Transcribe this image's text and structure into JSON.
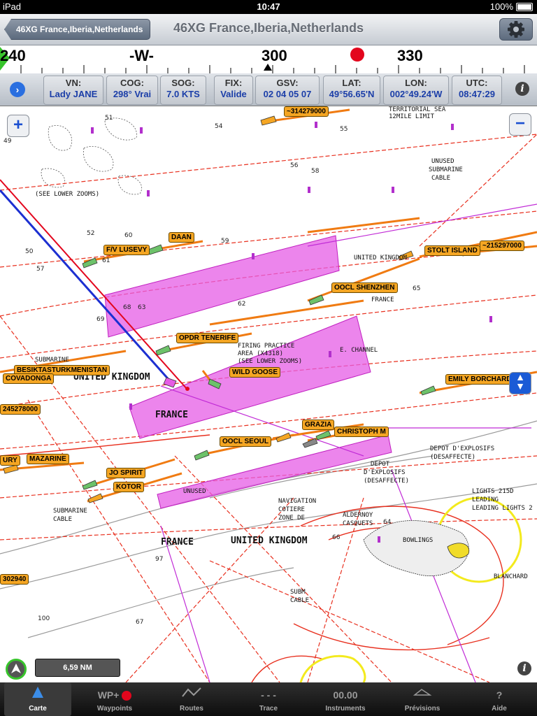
{
  "status_bar": {
    "device": "iPad",
    "time": "10:47",
    "battery": "100%"
  },
  "nav": {
    "back_label": "46XG France,Iberia,Netherlands",
    "title": "46XG France,Iberia,Netherlands",
    "settings_icon": "gear-icon"
  },
  "compass": {
    "labels": [
      "240",
      "-W-",
      "300",
      "330"
    ],
    "marker_color": "#e3061d"
  },
  "info": {
    "cells": [
      {
        "label": "VN:",
        "value": "Lady JANE"
      },
      {
        "label": "COG:",
        "value": "298° Vrai"
      },
      {
        "label": "SOG:",
        "value": "7.0 KTS"
      },
      {
        "label": "FIX:",
        "value": "Valide"
      },
      {
        "label": "GSV:",
        "value": "02 04 05 07"
      },
      {
        "label": "LAT:",
        "value": "49°56.65'N"
      },
      {
        "label": "LON:",
        "value": "002°49.24'W"
      },
      {
        "label": "UTC:",
        "value": "08:47:29"
      }
    ]
  },
  "map": {
    "zoom_in": "+",
    "zoom_out": "−",
    "scale": "6,59 NM",
    "labels": [
      "TERRITORIAL SEA",
      "12MILE LIMIT",
      "UNUSED",
      "SUBMARINE",
      "CABLE",
      "(SEE LOWER ZOOMS)",
      "UNITED KINGDOM",
      "FRANCE",
      "FIRING PRACTICE",
      "AREA (X4318)",
      "(SEE LOWER ZOOMS)",
      "E. CHANNEL",
      "UNITED KINGDOM",
      "FRANCE",
      "SUBMARINE",
      "DEPOT D'EXPLOSIFS",
      "(DESAFFECTE)",
      "DEPOT",
      "D'EXPLOSIFS",
      "(DESAFFECTE)",
      "NAVIGATION",
      "COTIERE",
      "ZONE DE",
      "ALDERNOY",
      "CASQUETS",
      "FRANCE",
      "UNITED KINGDOM",
      "LIGHTS 215D",
      "LEADING",
      "LEADING LIGHTS 2",
      "SUBMARINE",
      "CABLE",
      "BOWLINGS",
      "BLANCHARD",
      "UNUSED",
      "SUBM",
      "CABLE"
    ],
    "vessels": [
      "~314279000",
      "DAAN",
      "F/V LUSEVY",
      "STOLT ISLAND",
      "~215297000",
      "OOCL SHENZHEN",
      "OPDR TENERIFE",
      "WILD GOOSE",
      "BESIKTASTURKMENISTAN",
      "COVADONGA",
      "EMILY BORCHARD",
      "245278000",
      "GRAZIA",
      "CHRISTOPH M",
      "OOCL SEOUL",
      "MAZARINE",
      "JO SPIRIT",
      "KOTOR",
      "302940",
      "URY"
    ],
    "depths": [
      "51",
      "54",
      "49",
      "55",
      "52",
      "50",
      "60",
      "61",
      "62",
      "57",
      "65",
      "63",
      "69",
      "56",
      "66",
      "64",
      "58",
      "59",
      "67",
      "68",
      "97",
      "100"
    ]
  },
  "tabs": [
    {
      "label": "Carte",
      "icon": "triangle-icon"
    },
    {
      "label": "Waypoints",
      "icon": "wp-plus-icon"
    },
    {
      "label": "Routes",
      "icon": "route-icon"
    },
    {
      "label": "Trace",
      "icon": "trace-icon"
    },
    {
      "label": "Instruments",
      "icon": "00.00"
    },
    {
      "label": "Prévisions",
      "icon": "forecast-icon"
    },
    {
      "label": "Aide",
      "icon": "?"
    }
  ]
}
